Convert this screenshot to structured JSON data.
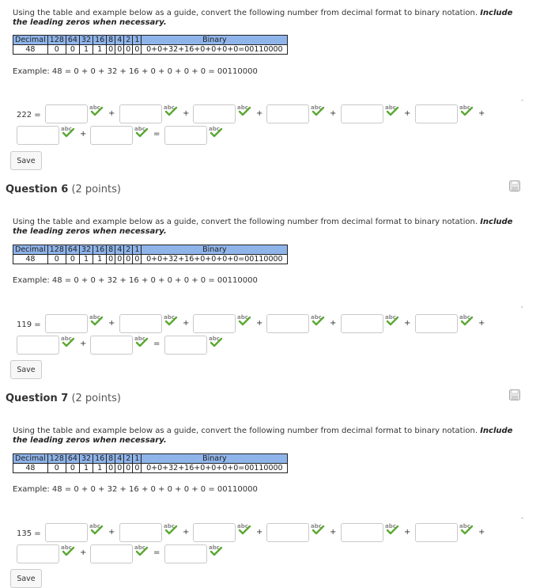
{
  "instruction": {
    "text": "Using the table and example below as a guide, convert the following number from decimal format to binary notation. ",
    "emphasis": "Include the leading zeros when necessary."
  },
  "reference_table": {
    "header": [
      "Decimal",
      "128",
      "64",
      "32",
      "16",
      "8",
      "4",
      "2",
      "1",
      "Binary"
    ],
    "row": [
      "48",
      "0",
      "0",
      "1",
      "1",
      "0",
      "0",
      "0",
      "0",
      "0+0+32+16+0+0+0+0=00110000"
    ]
  },
  "example": "Example: 48 = 0 + 0 + 32 + 16 + 0 + 0 + 0 + 0 = 00110000",
  "operators": {
    "plus": "+",
    "equals": "="
  },
  "save_label": "Save",
  "questions": [
    {
      "number_label": "222 ="
    },
    {
      "title": "Question 6",
      "points": "(2 points)",
      "number_label": "119 ="
    },
    {
      "title": "Question 7",
      "points": "(2 points)",
      "number_label": "135 ="
    }
  ]
}
